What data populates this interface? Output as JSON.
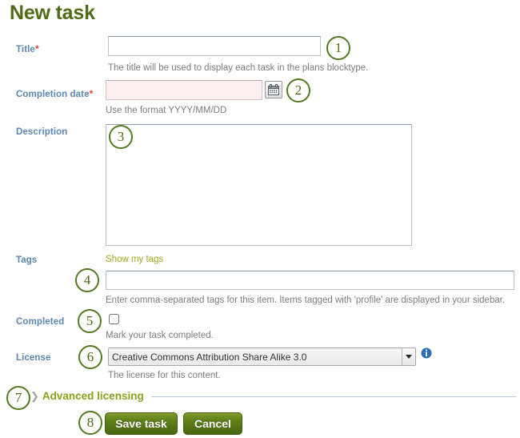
{
  "page": {
    "title": "New task"
  },
  "form": {
    "title_field": {
      "label": "Title",
      "required_mark": "*",
      "value": "",
      "help": "The title will be used to display each task in the plans blocktype."
    },
    "completion_date_field": {
      "label": "Completion date",
      "required_mark": "*",
      "value": "",
      "help": "Use the format YYYY/MM/DD",
      "calendar_icon": "calendar-icon"
    },
    "description_field": {
      "label": "Description",
      "value": ""
    },
    "tags_field": {
      "label": "Tags",
      "show_my_tags_link": "Show my tags",
      "value": "",
      "help": "Enter comma-separated tags for this item. Items tagged with 'profile' are displayed in your sidebar."
    },
    "completed_field": {
      "label": "Completed",
      "checked": false,
      "help": "Mark your task completed."
    },
    "license_field": {
      "label": "License",
      "selected": "Creative Commons Attribution Share Alike 3.0",
      "options": [
        "Creative Commons Attribution Share Alike 3.0"
      ],
      "help": "The license for this content.",
      "info_icon": "info-icon"
    },
    "advanced_licensing": {
      "label": "Advanced licensing",
      "chevron_icon": "chevron-right-icon",
      "expanded": false
    },
    "actions": {
      "save_label": "Save task",
      "cancel_label": "Cancel"
    }
  },
  "markers": [
    {
      "number": "1"
    },
    {
      "number": "2"
    },
    {
      "number": "3"
    },
    {
      "number": "4"
    },
    {
      "number": "5"
    },
    {
      "number": "6"
    },
    {
      "number": "7"
    },
    {
      "number": "8"
    }
  ],
  "colors": {
    "heading": "#4f6b16",
    "label": "#5c87b2",
    "required": "#e8413a",
    "help": "#7d7d7d",
    "link": "#a0a820",
    "button": "#5f7f18",
    "marker": "#567a22",
    "collapsible": "#8fa01b",
    "required_field_bg": "#fdeef0",
    "info": "#2a6ebb"
  }
}
